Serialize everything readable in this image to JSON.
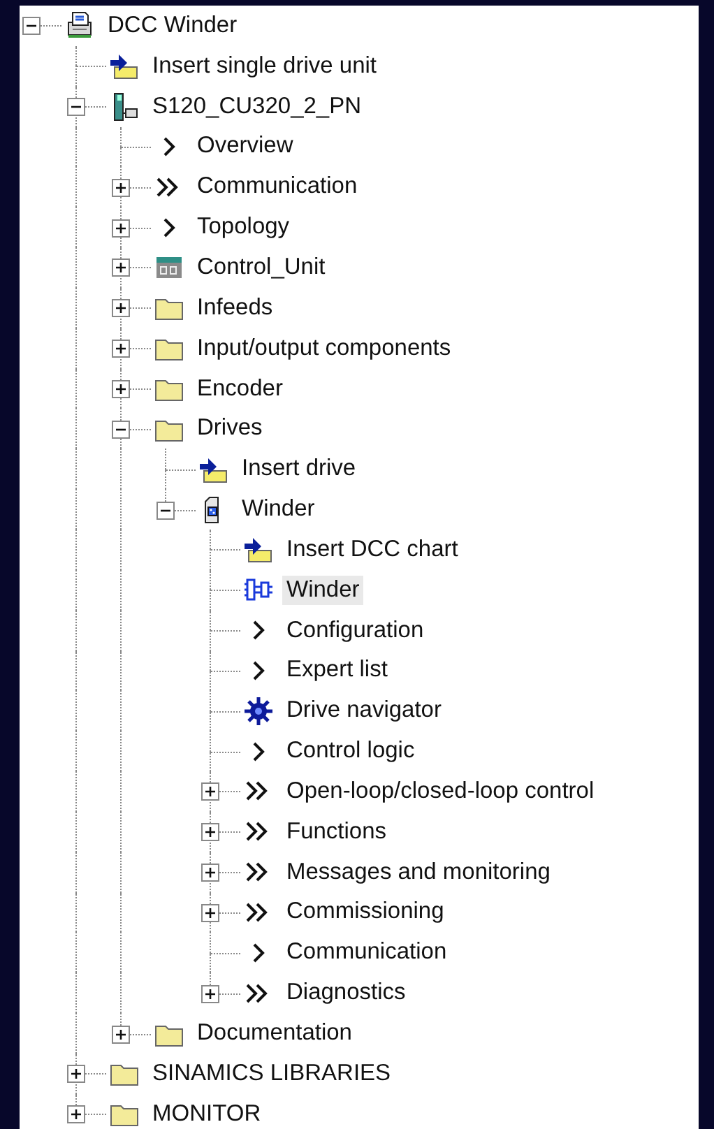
{
  "tree": [
    {
      "label": "DCC Winder",
      "kind": "project",
      "expanded": true,
      "selected": false,
      "children": [
        {
          "label": "Insert single drive unit",
          "kind": "insert",
          "selected": false
        },
        {
          "label": "S120_CU320_2_PN",
          "kind": "unit",
          "expanded": true,
          "selected": false,
          "children": [
            {
              "label": "Overview",
              "kind": "chevron",
              "selected": false
            },
            {
              "label": "Communication",
              "kind": "double",
              "expanded": false,
              "selected": false
            },
            {
              "label": "Topology",
              "kind": "chevron",
              "expanded": false,
              "selected": false
            },
            {
              "label": "Control_Unit",
              "kind": "cu",
              "expanded": false,
              "selected": false
            },
            {
              "label": "Infeeds",
              "kind": "folder",
              "expanded": false,
              "selected": false
            },
            {
              "label": "Input/output components",
              "kind": "folder",
              "expanded": false,
              "selected": false
            },
            {
              "label": "Encoder",
              "kind": "folder",
              "expanded": false,
              "selected": false
            },
            {
              "label": "Drives",
              "kind": "folder",
              "expanded": true,
              "selected": false,
              "children": [
                {
                  "label": "Insert drive",
                  "kind": "insert",
                  "selected": false
                },
                {
                  "label": "Winder",
                  "kind": "drive",
                  "expanded": true,
                  "selected": false,
                  "children": [
                    {
                      "label": "Insert DCC chart",
                      "kind": "insert",
                      "selected": false
                    },
                    {
                      "label": "Winder",
                      "kind": "chart",
                      "selected": true
                    },
                    {
                      "label": "Configuration",
                      "kind": "chevron",
                      "selected": false
                    },
                    {
                      "label": "Expert list",
                      "kind": "chevron",
                      "selected": false
                    },
                    {
                      "label": "Drive navigator",
                      "kind": "navigator",
                      "selected": false
                    },
                    {
                      "label": "Control logic",
                      "kind": "chevron",
                      "selected": false
                    },
                    {
                      "label": "Open-loop/closed-loop control",
                      "kind": "double",
                      "expanded": false,
                      "selected": false
                    },
                    {
                      "label": "Functions",
                      "kind": "double",
                      "expanded": false,
                      "selected": false
                    },
                    {
                      "label": "Messages and monitoring",
                      "kind": "double",
                      "expanded": false,
                      "selected": false
                    },
                    {
                      "label": "Commissioning",
                      "kind": "double",
                      "expanded": false,
                      "selected": false
                    },
                    {
                      "label": "Communication",
                      "kind": "chevron",
                      "selected": false
                    },
                    {
                      "label": "Diagnostics",
                      "kind": "double",
                      "expanded": false,
                      "selected": false
                    }
                  ]
                }
              ]
            },
            {
              "label": "Documentation",
              "kind": "folder",
              "expanded": false,
              "selected": false
            }
          ]
        },
        {
          "label": "SINAMICS LIBRARIES",
          "kind": "folder",
          "expanded": false,
          "selected": false
        },
        {
          "label": "MONITOR",
          "kind": "folder",
          "expanded": false,
          "selected": false
        }
      ]
    }
  ]
}
